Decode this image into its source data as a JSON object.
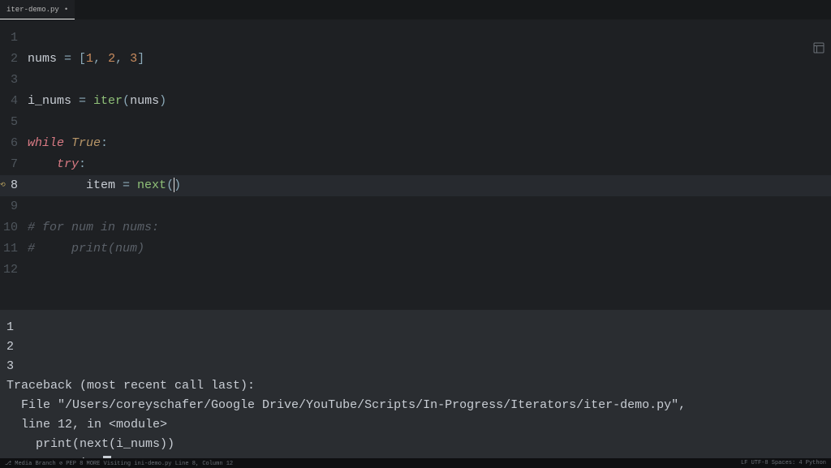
{
  "tab": {
    "filename": "iter-demo.py",
    "modified": "•"
  },
  "code": {
    "lines": [
      {
        "n": "1",
        "segs": []
      },
      {
        "n": "2",
        "segs": [
          [
            "id",
            "nums"
          ],
          [
            "op",
            " = "
          ],
          [
            "p",
            "["
          ],
          [
            "num",
            "1"
          ],
          [
            "p",
            ", "
          ],
          [
            "num",
            "2"
          ],
          [
            "p",
            ", "
          ],
          [
            "num",
            "3"
          ],
          [
            "p",
            "]"
          ]
        ]
      },
      {
        "n": "3",
        "segs": []
      },
      {
        "n": "4",
        "segs": [
          [
            "id",
            "i_nums"
          ],
          [
            "op",
            " = "
          ],
          [
            "fn",
            "iter"
          ],
          [
            "p",
            "("
          ],
          [
            "id",
            "nums"
          ],
          [
            "p",
            ")"
          ]
        ]
      },
      {
        "n": "5",
        "segs": []
      },
      {
        "n": "6",
        "segs": [
          [
            "kw",
            "while"
          ],
          [
            "id",
            " "
          ],
          [
            "bkw",
            "True"
          ],
          [
            "p",
            ":"
          ]
        ]
      },
      {
        "n": "7",
        "segs": [
          [
            "id",
            "    "
          ],
          [
            "kw",
            "try"
          ],
          [
            "p",
            ":"
          ]
        ]
      },
      {
        "n": "8",
        "active": true,
        "segs": [
          [
            "id",
            "        item"
          ],
          [
            "op",
            " = "
          ],
          [
            "fn",
            "next"
          ],
          [
            "p",
            "("
          ],
          [
            "cursor",
            ""
          ],
          [
            "p",
            ")"
          ]
        ]
      },
      {
        "n": "9",
        "segs": []
      },
      {
        "n": "10",
        "segs": [
          [
            "comment",
            "# for num in nums:"
          ]
        ]
      },
      {
        "n": "11",
        "segs": [
          [
            "comment",
            "#     print(num)"
          ]
        ]
      },
      {
        "n": "12",
        "segs": []
      }
    ]
  },
  "terminal": {
    "lines": [
      "1",
      "2",
      "3",
      "Traceback (most recent call last):",
      "  File \"/Users/coreyschafer/Google Drive/YouTube/Scripts/In-Progress/Iterators/iter-demo.py\",",
      "  line 12, in <module>",
      "    print(next(i_nums))",
      "StopIteration"
    ]
  },
  "status": {
    "left": "⎇ Media Branch  ⊘ PEP 8 MORE  Visiting ini-demo.py  Line 8, Column 12",
    "right": "LF  UTF-8  Spaces: 4  Python"
  }
}
